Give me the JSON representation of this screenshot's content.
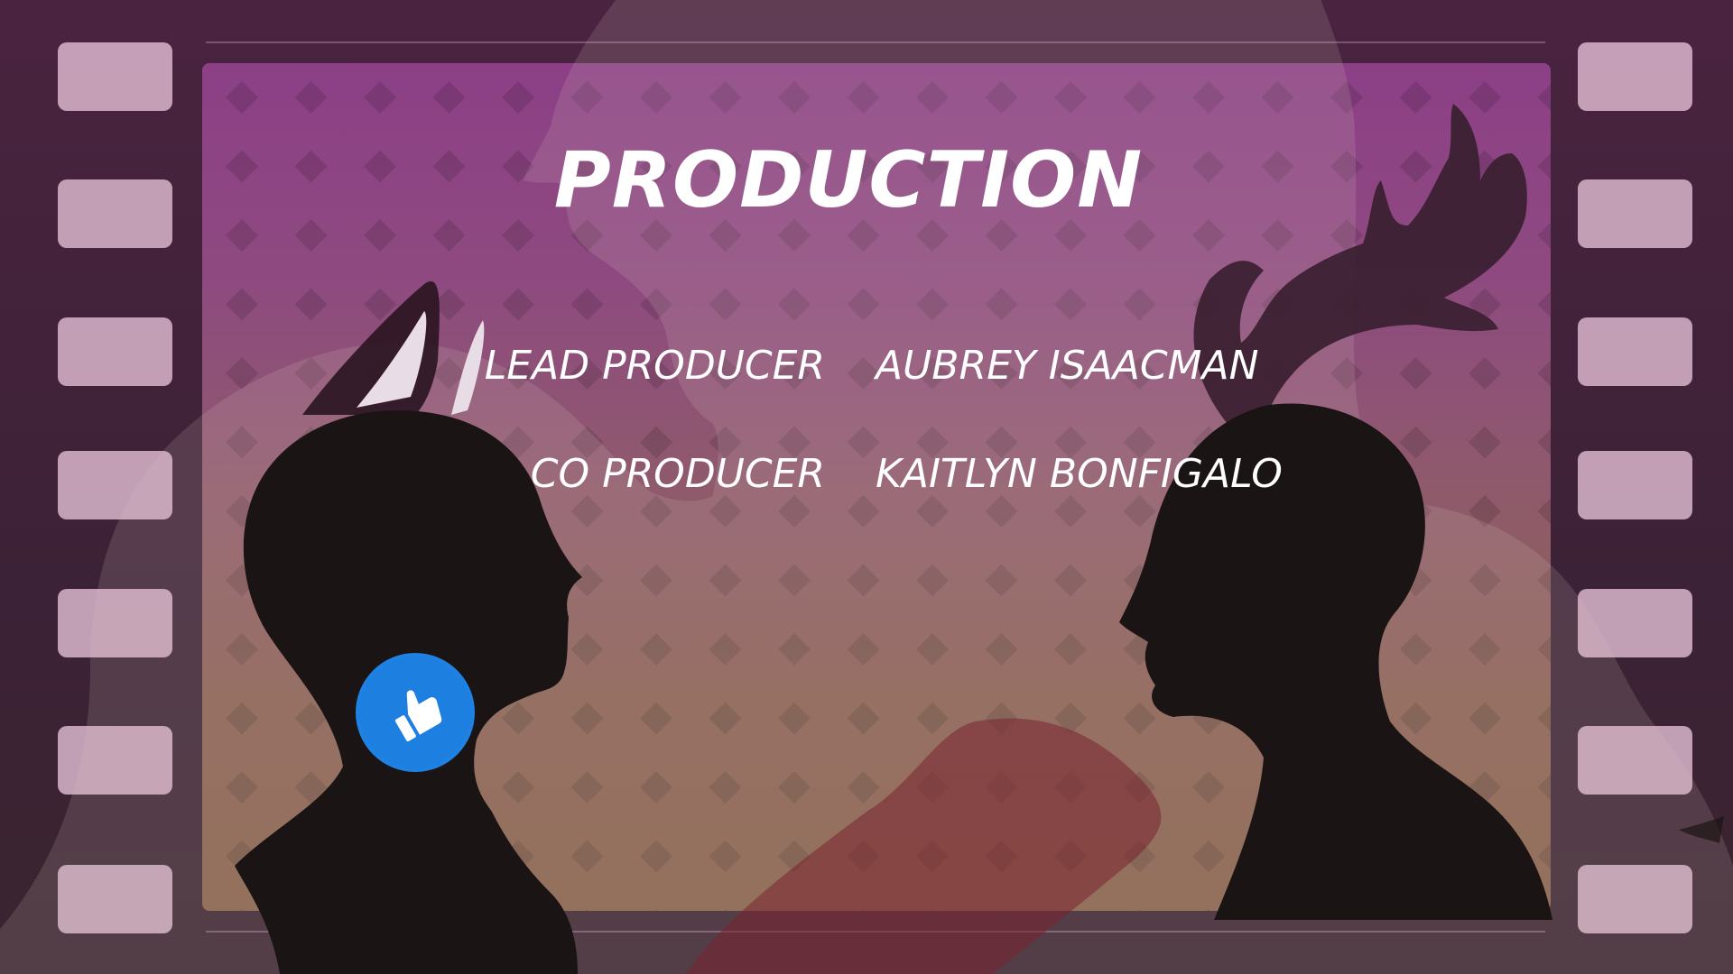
{
  "scene": {
    "title": "PRODUCTION",
    "credits": [
      {
        "role": "LEAD PRODUCER",
        "name": "AUBREY ISAACMAN"
      },
      {
        "role": "CO PRODUCER",
        "name": "KAITLYN BONFIGALO"
      }
    ]
  },
  "icons": {
    "like": "thumbs-up-icon"
  },
  "colors": {
    "film_strip": "#3c2236",
    "screen_top": "#8c3f86",
    "screen_bottom": "#86614a",
    "sprocket_hole": "#e7c3d9",
    "silhouette": "#1b1414",
    "like_button": "#1d7fe0",
    "text": "#ffffff"
  }
}
